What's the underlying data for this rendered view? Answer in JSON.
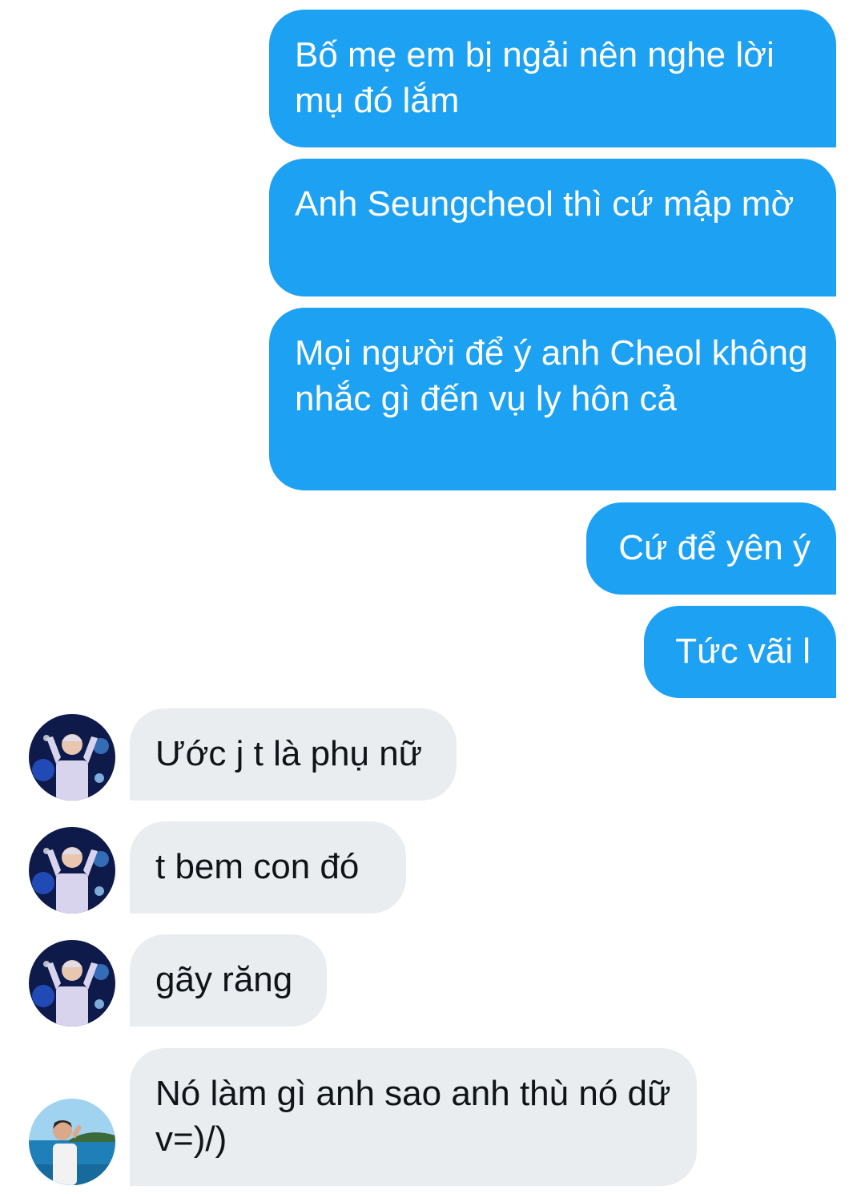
{
  "conversation": {
    "sent": [
      {
        "text": "Bố mẹ em bị ngải nên nghe lời mụ đó lắm"
      },
      {
        "text": "Anh Seungcheol thì cứ mập mờ"
      },
      {
        "text": "Mọi người để ý anh Cheol không nhắc gì đến vụ ly hôn cả"
      },
      {
        "text": "Cứ để yên ý"
      },
      {
        "text": "Tức vãi l"
      }
    ],
    "received": [
      {
        "text": "Ước j t là phụ nữ",
        "avatar": "concert-person-avatar"
      },
      {
        "text": "t bem con đó",
        "avatar": "concert-person-avatar"
      },
      {
        "text": "gãy răng",
        "avatar": "concert-person-avatar"
      },
      {
        "text": "Nó làm gì anh sao anh thù nó dữ v=)/)",
        "avatar": "beach-person-avatar"
      }
    ]
  },
  "colors": {
    "sent_bubble": "#1da1f2",
    "sent_text": "#ffffff",
    "received_bubble": "#e9edf0",
    "received_text": "#0f1419"
  }
}
